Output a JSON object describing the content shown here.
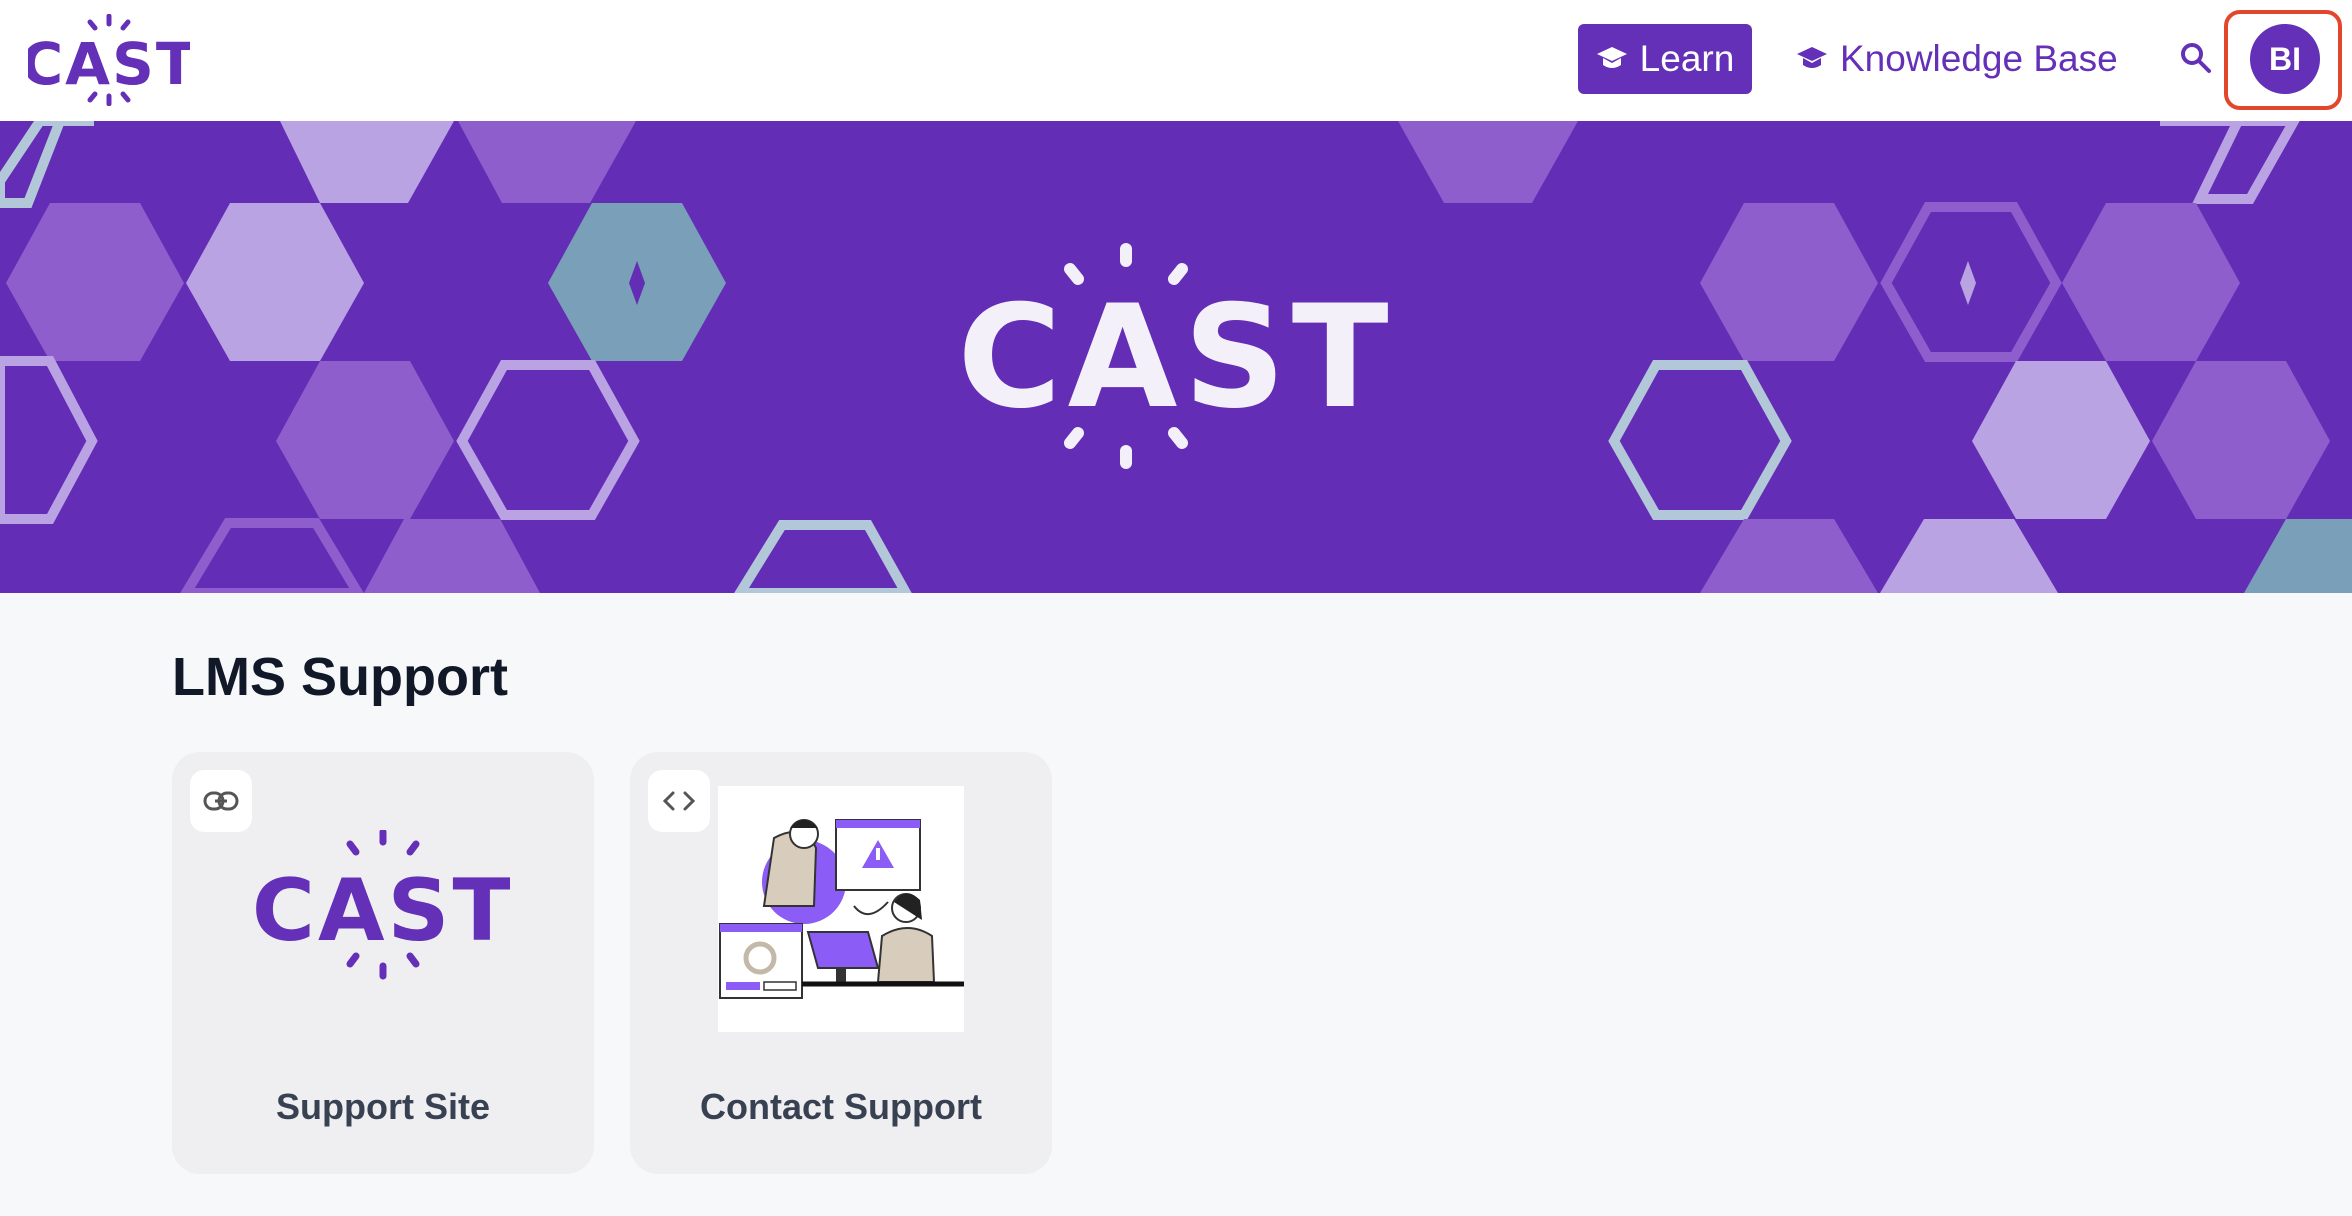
{
  "header": {
    "brand": "CAST",
    "nav": {
      "learn_label": "Learn",
      "knowledge_base_label": "Knowledge Base"
    },
    "search_icon": "search-icon",
    "avatar_initials": "BI"
  },
  "banner": {
    "brand": "CAST"
  },
  "section": {
    "title": "LMS Support",
    "cards": [
      {
        "label": "Support Site",
        "badge_icon": "link-icon"
      },
      {
        "label": "Contact Support",
        "badge_icon": "code-icon"
      }
    ]
  },
  "colors": {
    "brand_purple": "#6430b8",
    "banner_bg": "#632db5",
    "accent_red": "#e2462b",
    "teal": "#7a9fb8"
  }
}
